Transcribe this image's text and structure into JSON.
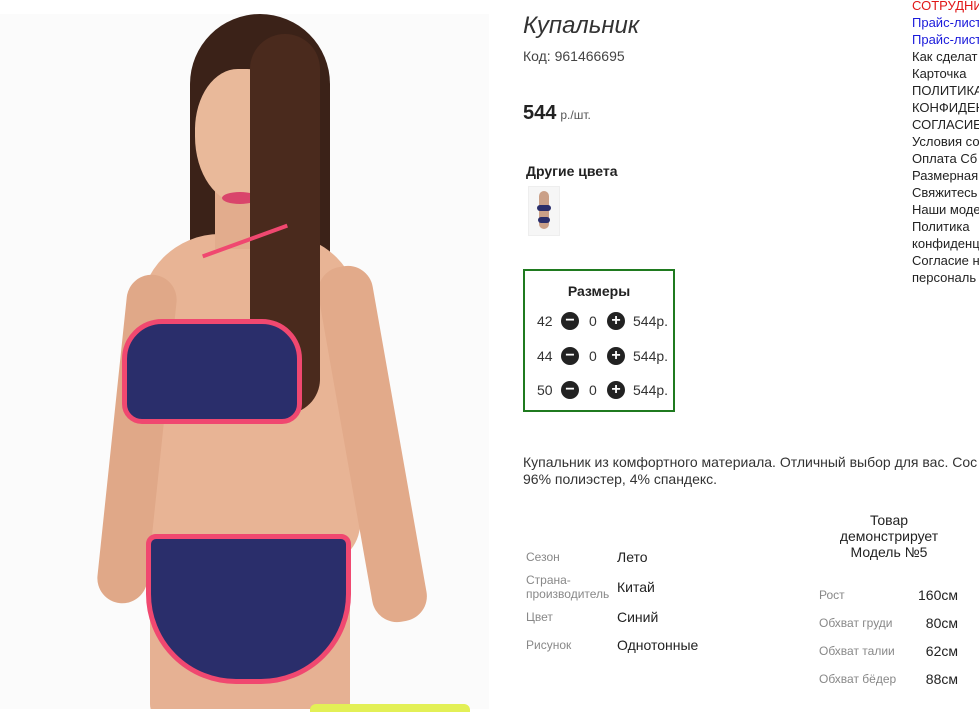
{
  "product": {
    "title": "Купальник",
    "code": "Код: 961466695",
    "price": "544",
    "price_unit": "р./шт."
  },
  "other_colors": {
    "title": "Другие цвета"
  },
  "sizes": {
    "title": "Размеры",
    "rows": [
      {
        "size": "42",
        "qty": "0",
        "price": "544р."
      },
      {
        "size": "44",
        "qty": "0",
        "price": "544р."
      },
      {
        "size": "50",
        "qty": "0",
        "price": "544р."
      }
    ]
  },
  "description": {
    "line1": "Купальник из комфортного материала. Отличный выбор для вас. Сос",
    "line2": "96% полиэстер, 4% спандекс."
  },
  "attributes": [
    {
      "label": "Сезон",
      "value": "Лето"
    },
    {
      "label": "Страна-производитель",
      "label_line1": "Страна-",
      "label_line2": "производитель",
      "value": "Китай"
    },
    {
      "label": "Цвет",
      "value": "Синий"
    },
    {
      "label": "Рисунок",
      "value": "Однотонные"
    }
  ],
  "model": {
    "heading_line1": "Товар",
    "heading_line2": "демонстрирует",
    "heading_line3": "Модель №5",
    "measurements": [
      {
        "label": "Рост",
        "value": "160см"
      },
      {
        "label": "Обхват груди",
        "value": "80см"
      },
      {
        "label": "Обхват талии",
        "value": "62см"
      },
      {
        "label": "Обхват бёдер",
        "value": "88см"
      }
    ]
  },
  "right_links": [
    "СОТРУДНИ",
    "Прайс-лист",
    "Прайс-лист",
    "Как сделат",
    "Карточка",
    "ПОЛИТИКА",
    "КОНФИДЕН",
    "СОГЛАСИЕ",
    "Условия со",
    "Оплата Сб",
    "Размерная",
    "Свяжитесь",
    "Наши моде",
    "Политика",
    "конфиденц",
    "Согласие н",
    "персональ"
  ],
  "colors": {
    "accent_border": "#1f7a1f",
    "link_red": "#e01818",
    "link_blue": "#1a1adb"
  }
}
